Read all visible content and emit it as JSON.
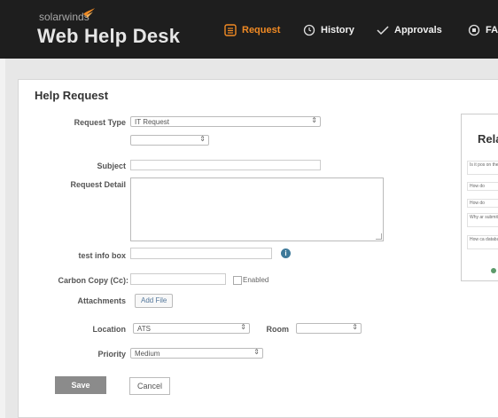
{
  "header": {
    "brand_small": "solarwinds",
    "brand_title": "Web Help Desk",
    "nav": [
      {
        "label": "Request",
        "active": true
      },
      {
        "label": "History",
        "active": false
      },
      {
        "label": "Approvals",
        "active": false
      },
      {
        "label": "FA",
        "active": false
      }
    ]
  },
  "form": {
    "title": "Help Request",
    "request_type_label": "Request Type",
    "request_type_value": "IT Request",
    "subject_label": "Subject",
    "request_detail_label": "Request Detail",
    "test_info_label": "test info box",
    "carbon_copy_label": "Carbon Copy (Cc):",
    "enabled_label": "Enabled",
    "attachments_label": "Attachments",
    "add_file_label": "Add File",
    "location_label": "Location",
    "location_value": "ATS",
    "room_label": "Room",
    "priority_label": "Priority",
    "priority_value": "Medium",
    "save_label": "Save",
    "cancel_label": "Cancel"
  },
  "related": {
    "title": "Rela",
    "items": [
      "Is it pos on the",
      "How do",
      "How do",
      "Why ar submitt",
      "How ca databa"
    ]
  },
  "colors": {
    "topbar": "#1e1e1e",
    "accent": "#f08a24",
    "info_icon": "#3f7a9a"
  }
}
